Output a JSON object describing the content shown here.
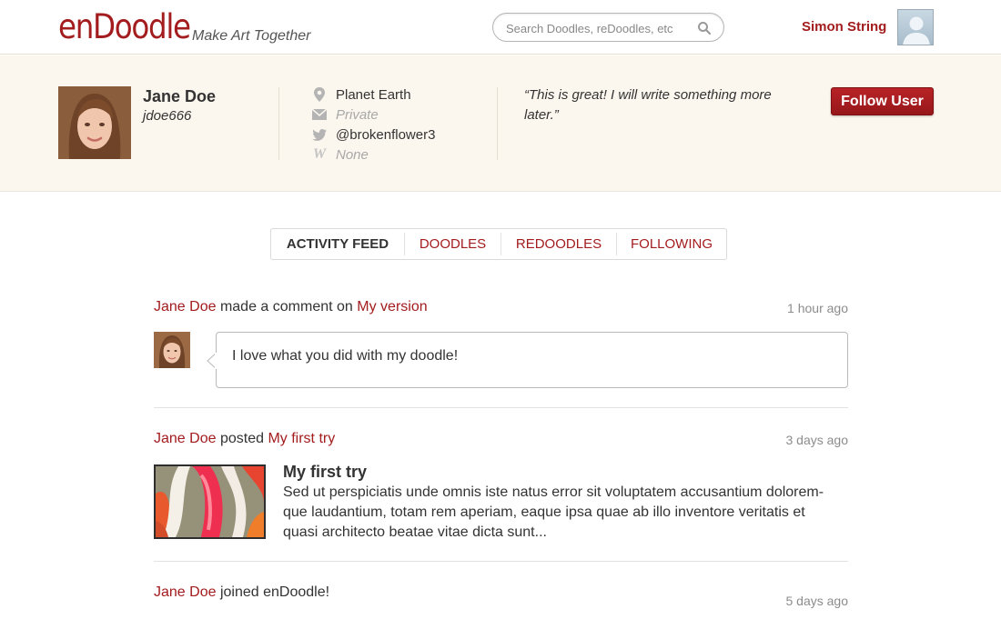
{
  "header": {
    "logo": "enDoodle",
    "tagline": "Make Art Together",
    "search_placeholder": "Search Doodles, reDoodles, etc",
    "current_user": "Simon String"
  },
  "profile": {
    "name": "Jane Doe",
    "handle": "jdoe666",
    "location": "Planet Earth",
    "email": "Private",
    "twitter": "@brokenflower3",
    "website": "None",
    "quote": "“This is great! I will write something more later.”",
    "follow_label": "Follow User"
  },
  "tabs": [
    {
      "label": "ACTIVITY FEED",
      "active": true
    },
    {
      "label": "DOODLES",
      "active": false
    },
    {
      "label": "REDOODLES",
      "active": false
    },
    {
      "label": "FOLLOWING",
      "active": false
    }
  ],
  "feed": [
    {
      "actor": "Jane Doe",
      "action": "made a comment on",
      "target": "My version",
      "time": "1 hour ago",
      "comment": "I love what you did with my doodle!"
    },
    {
      "actor": "Jane Doe",
      "action": "posted",
      "target": "My first try",
      "time": "3 days ago",
      "post_title": "My first try",
      "post_body": "Sed ut perspiciatis unde omnis iste natus error sit voluptatem accusantium dolorem­que laudantium, totam rem aperiam, eaque ipsa quae ab illo inventore veritatis et quasi architecto beatae vitae dicta sunt..."
    },
    {
      "actor": "Jane Doe",
      "action": "joined enDoodle!",
      "time": "5 days ago"
    }
  ],
  "colors": {
    "brand": "#a31c1e",
    "profile_band": "#fcf7ee",
    "muted_text": "#8c8c8c"
  }
}
